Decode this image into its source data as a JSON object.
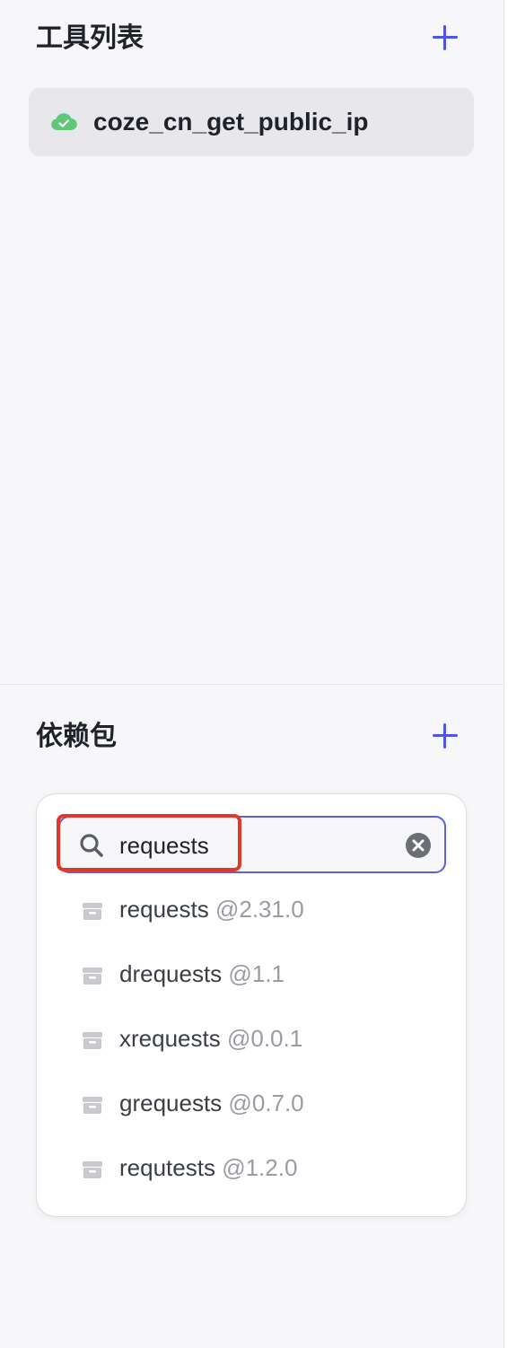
{
  "tools_section": {
    "title": "工具列表",
    "add_icon": "plus-icon",
    "items": [
      {
        "label": "coze_cn_get_public_ip",
        "status_icon": "cloud-check-icon"
      }
    ]
  },
  "deps_section": {
    "title": "依赖包",
    "add_icon": "plus-icon",
    "search": {
      "value": "requests",
      "icon": "search-icon",
      "clear_icon": "clear-circle-icon"
    },
    "results": [
      {
        "name": "requests",
        "version": "@2.31.0"
      },
      {
        "name": "drequests",
        "version": "@1.1"
      },
      {
        "name": "xrequests",
        "version": "@0.0.1"
      },
      {
        "name": "grequests",
        "version": "@0.7.0"
      },
      {
        "name": "requtests",
        "version": "@1.2.0"
      }
    ]
  },
  "colors": {
    "accent": "#4d53e8",
    "success": "#5fc77a",
    "highlight": "#e0382b",
    "muted": "#9a9ca3"
  }
}
